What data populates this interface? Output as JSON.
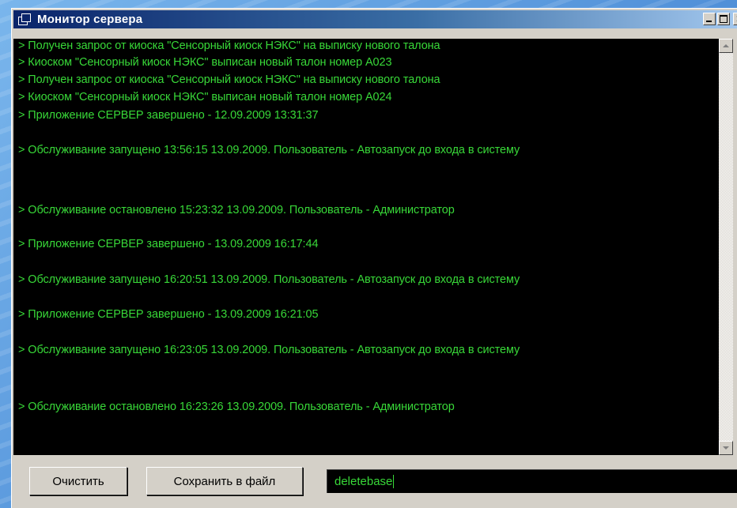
{
  "window": {
    "title": "Монитор сервера"
  },
  "log": {
    "lines": [
      ">  Получен запрос от киоска \"Сенсорный киоск НЭКС\" на выписку нового талона",
      ">  Киоском \"Сенсорный киоск НЭКС\" выписан новый талон номер А023",
      ">  Получен запрос от киоска \"Сенсорный киоск НЭКС\" на выписку нового талона",
      ">  Киоском \"Сенсорный киоск НЭКС\" выписан новый талон номер А024",
      ">  Приложение СЕРВЕР завершено - 12.09.2009 13:31:37",
      "> Обслуживание запущено 13:56:15 13.09.2009. Пользователь - Автозапуск до входа в систему",
      "> Обслуживание остановлено 15:23:32 13.09.2009. Пользователь - Администратор",
      ">  Приложение СЕРВЕР завершено - 13.09.2009 16:17:44",
      "> Обслуживание запущено 16:20:51 13.09.2009. Пользователь - Автозапуск до входа в систему",
      ">  Приложение СЕРВЕР завершено - 13.09.2009 16:21:05",
      "> Обслуживание запущено 16:23:05 13.09.2009. Пользователь - Автозапуск до входа в систему",
      "> Обслуживание остановлено 16:23:26 13.09.2009. Пользователь - Администратор"
    ]
  },
  "buttons": {
    "clear_label": "Очистить",
    "save_label": "Сохранить в файл"
  },
  "command_input": {
    "value": "deletebase"
  },
  "icons": {
    "window": "app-window-icon",
    "minimize": "minimize-icon",
    "maximize": "maximize-icon",
    "close": "close-icon",
    "scroll_up": "scroll-up-arrow-icon",
    "scroll_down": "scroll-down-arrow-icon"
  },
  "colors": {
    "log_text": "#38d838",
    "log_background": "#000000",
    "titlebar_start": "#0a246a",
    "titlebar_end": "#a6caf0",
    "window_face": "#d4d0c8"
  }
}
